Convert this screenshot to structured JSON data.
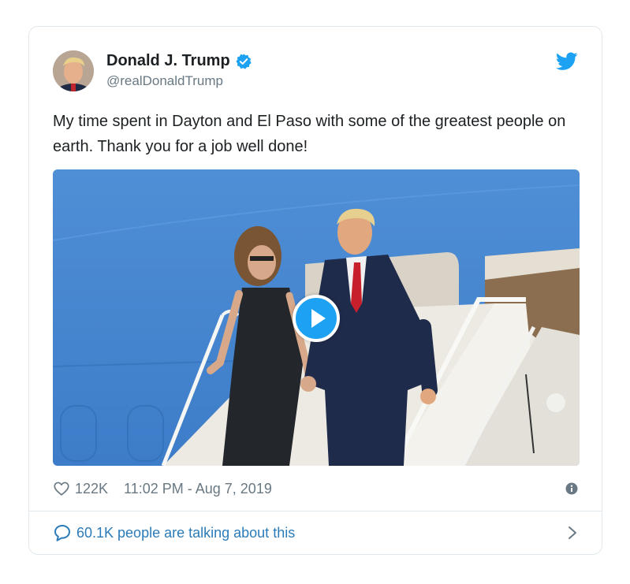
{
  "author": {
    "display_name": "Donald J. Trump",
    "handle": "@realDonaldTrump",
    "verified": true
  },
  "tweet": {
    "text": "My time spent in Dayton and El Paso with some of the greatest people on earth. Thank you for a job well done!"
  },
  "media": {
    "type": "video"
  },
  "stats": {
    "likes": "122K",
    "timestamp": "11:02 PM - Aug 7, 2019"
  },
  "conversation": {
    "label": "60.1K people are talking about this"
  },
  "colors": {
    "twitter_blue": "#1da1f2",
    "link_blue": "#2b7bb9",
    "muted_gray": "#697882",
    "border": "#e1e8ed"
  },
  "icons": {
    "verified": "verified-badge-icon",
    "brand": "twitter-bird-icon",
    "like": "heart-outline-icon",
    "info": "info-circle-icon",
    "conversation": "speech-bubble-icon",
    "chevron": "chevron-right-icon",
    "play": "play-icon"
  }
}
